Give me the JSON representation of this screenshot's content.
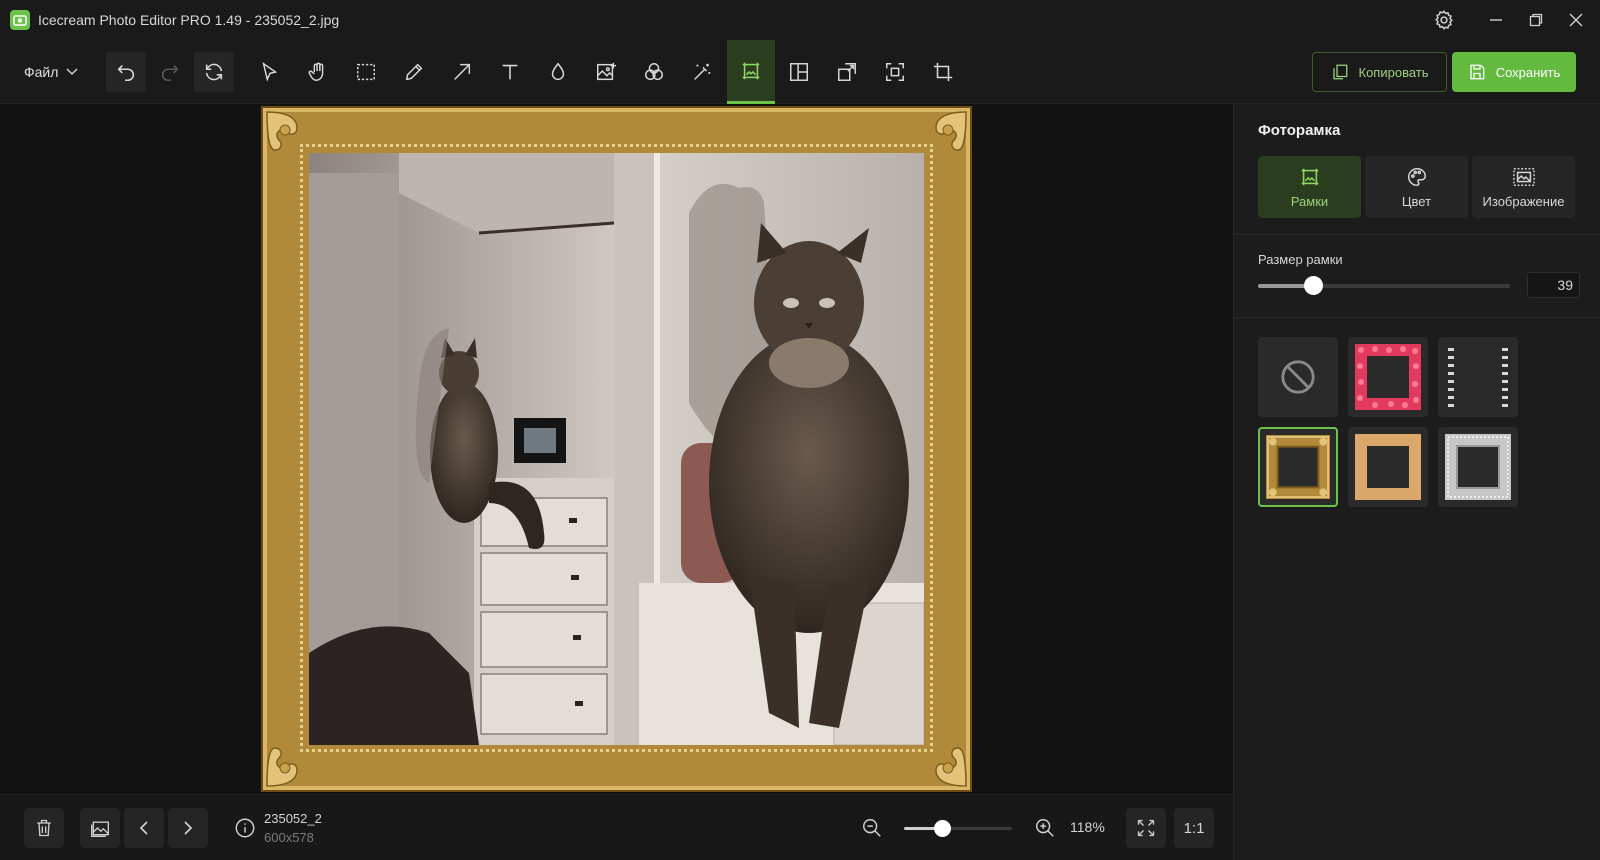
{
  "window": {
    "title": "Icecream Photo Editor PRO 1.49 - 235052_2.jpg"
  },
  "toolbar": {
    "file_menu_label": "Файл",
    "copy_label": "Копировать",
    "save_label": "Сохранить",
    "tools": [
      "select-tool",
      "hand-tool",
      "rect-select-tool",
      "pencil-tool",
      "arrow-tool",
      "text-tool",
      "drop-tool",
      "image-add-tool",
      "filters-tool",
      "magic-wand-tool",
      "photo-frame-tool",
      "collage-tool",
      "resize-tool",
      "crop-selection-tool",
      "crop-tool"
    ],
    "active_tool": "photo-frame-tool"
  },
  "bottom": {
    "file_name": "235052_2",
    "file_dims": "600x578",
    "zoom_value": "118%",
    "zoom_level": 0.35,
    "one_to_one": "1:1"
  },
  "panel": {
    "title": "Фоторамка",
    "tabs": [
      {
        "label": "Рамки",
        "active": true
      },
      {
        "label": "Цвет",
        "active": false
      },
      {
        "label": "Изображение",
        "active": false
      }
    ],
    "size_label": "Размер рамки",
    "size_value": "39",
    "size_fraction": 0.22,
    "frames": [
      "none",
      "red-flowers",
      "film-strip",
      "gold-ornate",
      "wood",
      "silver"
    ],
    "selected_frame": "gold-ornate"
  },
  "colors": {
    "accent": "#6cc24a",
    "background": "#121212",
    "panel": "#1c1c1c",
    "gold": "#b08a3a"
  }
}
